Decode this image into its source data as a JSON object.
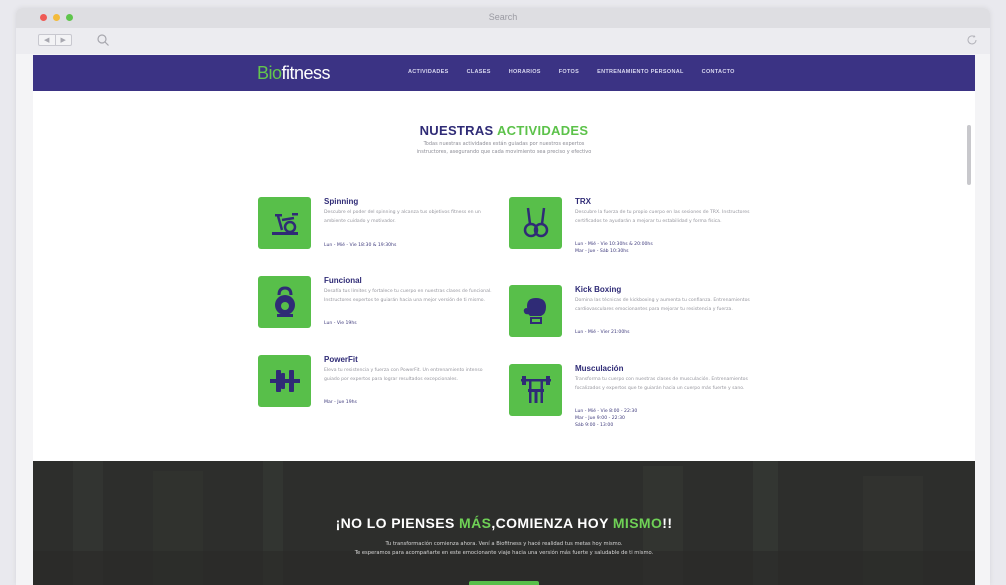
{
  "browser": {
    "title": "Search",
    "back_label": "◀",
    "forward_label": "▶"
  },
  "site": {
    "logo_bio": "Bio",
    "logo_fitness": "fitness",
    "nav": [
      "ACTIVIDADES",
      "CLASES",
      "HORARIOS",
      "FOTOS",
      "ENTRENAMIENTO PERSONAL",
      "CONTACTO"
    ]
  },
  "activities": {
    "title_main": "NUESTRAS",
    "title_accent": "ACTIVIDADES",
    "subtitle_line1": "Todas nuestras actividades están guiadas por nuestros expertos",
    "subtitle_line2": "instructores, asegurando que cada movimiento sea preciso y efectivo",
    "items": [
      {
        "name": "Spinning",
        "icon": "spinning-bike-icon",
        "desc": "Descubre el poder del spinning y alcanza tus objetivos fitness en un ambiente cuidado y motivador.",
        "sched1": "Lun - Mié - Vie 18:30 & 19:30hs",
        "sched2": "",
        "sched3": ""
      },
      {
        "name": "TRX",
        "icon": "trx-rings-icon",
        "desc": "Descubre la fuerza de tu propio cuerpo en las sesiones de TRX. Instructores certificados te ayudarán a mejorar tu estabilidad y forma física.",
        "sched1": "Lun - Mié - Vie 10:30hs & 20:00hs",
        "sched2": "Mar - Jue - Sáb 10:30hs",
        "sched3": ""
      },
      {
        "name": "Funcional",
        "icon": "kettlebell-icon",
        "desc": "Desafía tus límites y fortalece tu cuerpo en nuestras clases de funcional. Instructores expertos te guiarán hacia una mejor versión de ti mismo.",
        "sched1": "Lun - Vie 19hs",
        "sched2": "",
        "sched3": ""
      },
      {
        "name": "Kick Boxing",
        "icon": "boxing-glove-icon",
        "desc": "Domina las técnicas de kickboxing y aumenta tu confianza. Entrenamientos cardiovasculares emocionantes para mejorar tu resistencia y fuerza.",
        "sched1": "Lun - Mié - Vier 21:00hs",
        "sched2": "",
        "sched3": ""
      },
      {
        "name": "PowerFit",
        "icon": "weight-plates-icon",
        "desc": "Eleva tu resistencia y fuerza con PowerFit. Un entrenamiento intenso guiado por expertos para lograr resultados excepcionales.",
        "sched1": "Mar - Jue 19hs",
        "sched2": "",
        "sched3": ""
      },
      {
        "name": "Musculación",
        "icon": "bench-press-icon",
        "desc": "Transforma tu cuerpo con nuestras clases de musculación. Entrenamientos focalizados y expertos que te guiarán hacia un cuerpo más fuerte y sano.",
        "sched1": "Lun - Mié - Vie 8:00 - 22:30",
        "sched2": "Mar - Jue 9:00 - 22:30",
        "sched3": "Sáb 9:00 - 13:00"
      }
    ]
  },
  "cta": {
    "p1": "¡NO LO PIENSES ",
    "p2": "MÁS",
    "p3": ",COMIENZA HOY ",
    "p4": "MISMO",
    "p5": "!!",
    "line1": "Tu transformación comienza ahora. Vení a Biofitness y hacé realidad tus metas hoy mismo.",
    "line2": "Te esperamos para acompañarte en este emocionante viaje hacia una versión más fuerte y saludable de ti mismo."
  },
  "colors": {
    "brand_purple": "#3b3384",
    "accent_green": "#58bf4a",
    "cta_dark": "#2f302e"
  }
}
